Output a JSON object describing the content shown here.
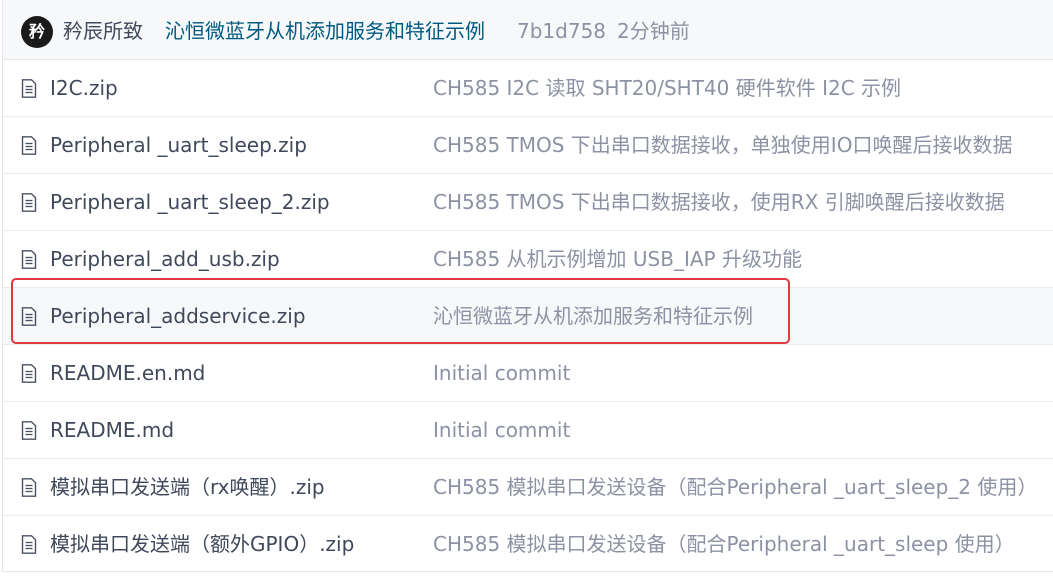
{
  "commit": {
    "avatar_text": "矜",
    "author": "矜辰所致",
    "message": "沁恒微蓝牙从机添加服务和特征示例",
    "sha": "7b1d758",
    "time": "2分钟前"
  },
  "files": [
    {
      "name": "I2C.zip",
      "commit": "CH585 I2C 读取 SHT20/SHT40 硬件软件 I2C 示例",
      "icon": "file-icon"
    },
    {
      "name": "Peripheral _uart_sleep.zip",
      "commit": "CH585 TMOS 下出串口数据接收，单独使用IO口唤醒后接收数据",
      "icon": "file-icon"
    },
    {
      "name": "Peripheral _uart_sleep_2.zip",
      "commit": "CH585 TMOS 下出串口数据接收，使用RX 引脚唤醒后接收数据",
      "icon": "file-icon"
    },
    {
      "name": "Peripheral_add_usb.zip",
      "commit": "CH585 从机示例增加 USB_IAP 升级功能",
      "icon": "file-icon"
    },
    {
      "name": "Peripheral_addservice.zip",
      "commit": "沁恒微蓝牙从机添加服务和特征示例",
      "icon": "file-icon"
    },
    {
      "name": "README.en.md",
      "commit": "Initial commit",
      "icon": "file-icon"
    },
    {
      "name": "README.md",
      "commit": "Initial commit",
      "icon": "file-icon"
    },
    {
      "name": "模拟串口发送端（rx唤醒）.zip",
      "commit": "CH585 模拟串口发送设备（配合Peripheral _uart_sleep_2 使用）",
      "icon": "file-icon"
    },
    {
      "name": "模拟串口发送端（额外GPIO）.zip",
      "commit": "CH585 模拟串口发送设备（配合Peripheral _uart_sleep 使用）",
      "icon": "file-icon"
    }
  ],
  "colors": {
    "link": "#005980",
    "text": "#40485b",
    "muted": "#8c92a4",
    "highlight": "#e0393e"
  }
}
